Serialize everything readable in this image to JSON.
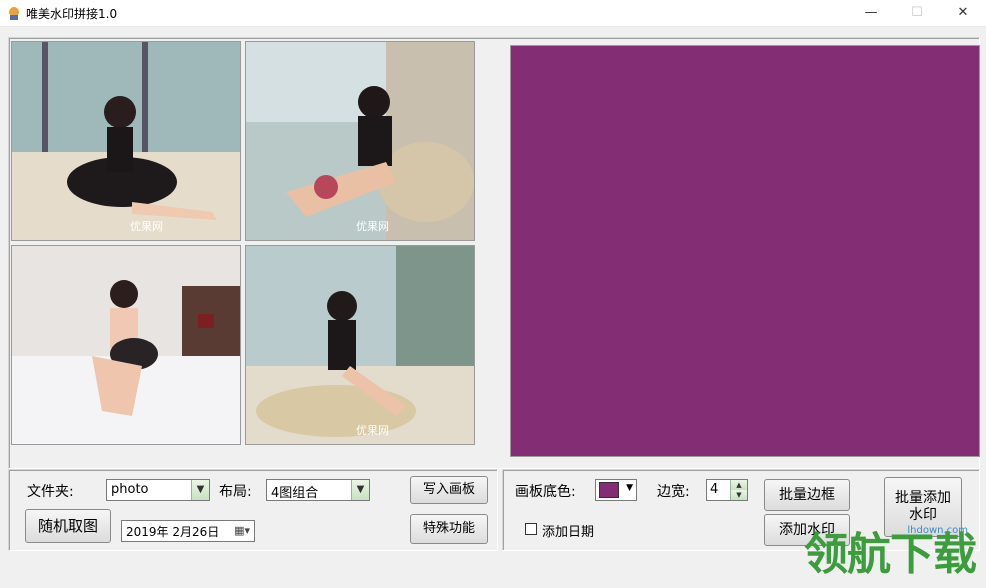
{
  "window": {
    "title": "唯美水印拼接1.0",
    "minimize_glyph": "—",
    "maximize_glyph": "☐",
    "close_glyph": "✕"
  },
  "thumbnails": [
    {
      "caption": "优果网"
    },
    {
      "caption": "优果网"
    },
    {
      "caption": ""
    },
    {
      "caption": "优果网"
    }
  ],
  "canvas": {
    "background_color": "#822d74"
  },
  "controls": {
    "folder_label": "文件夹:",
    "folder_value": "photo",
    "layout_label": "布局:",
    "layout_value": "4图组合",
    "write_canvas_button": "写入画板",
    "random_pick_button": "随机取图",
    "date_value": "2019年 2月26日",
    "special_button": "特殊功能",
    "board_color_label": "画板底色:",
    "border_width_label": "边宽:",
    "border_width_value": "4",
    "batch_border_button": "批量边框",
    "add_date_label": "添加日期",
    "add_watermark_button": "添加水印",
    "batch_watermark_button_line1": "批量添加",
    "batch_watermark_button_line2": "水印"
  },
  "watermark": {
    "text": "领航下载",
    "url": "lhdown.com"
  },
  "colors": {
    "board": "#822d74",
    "swatch": "#822d74",
    "watermark_green": "#3b9d3b"
  }
}
